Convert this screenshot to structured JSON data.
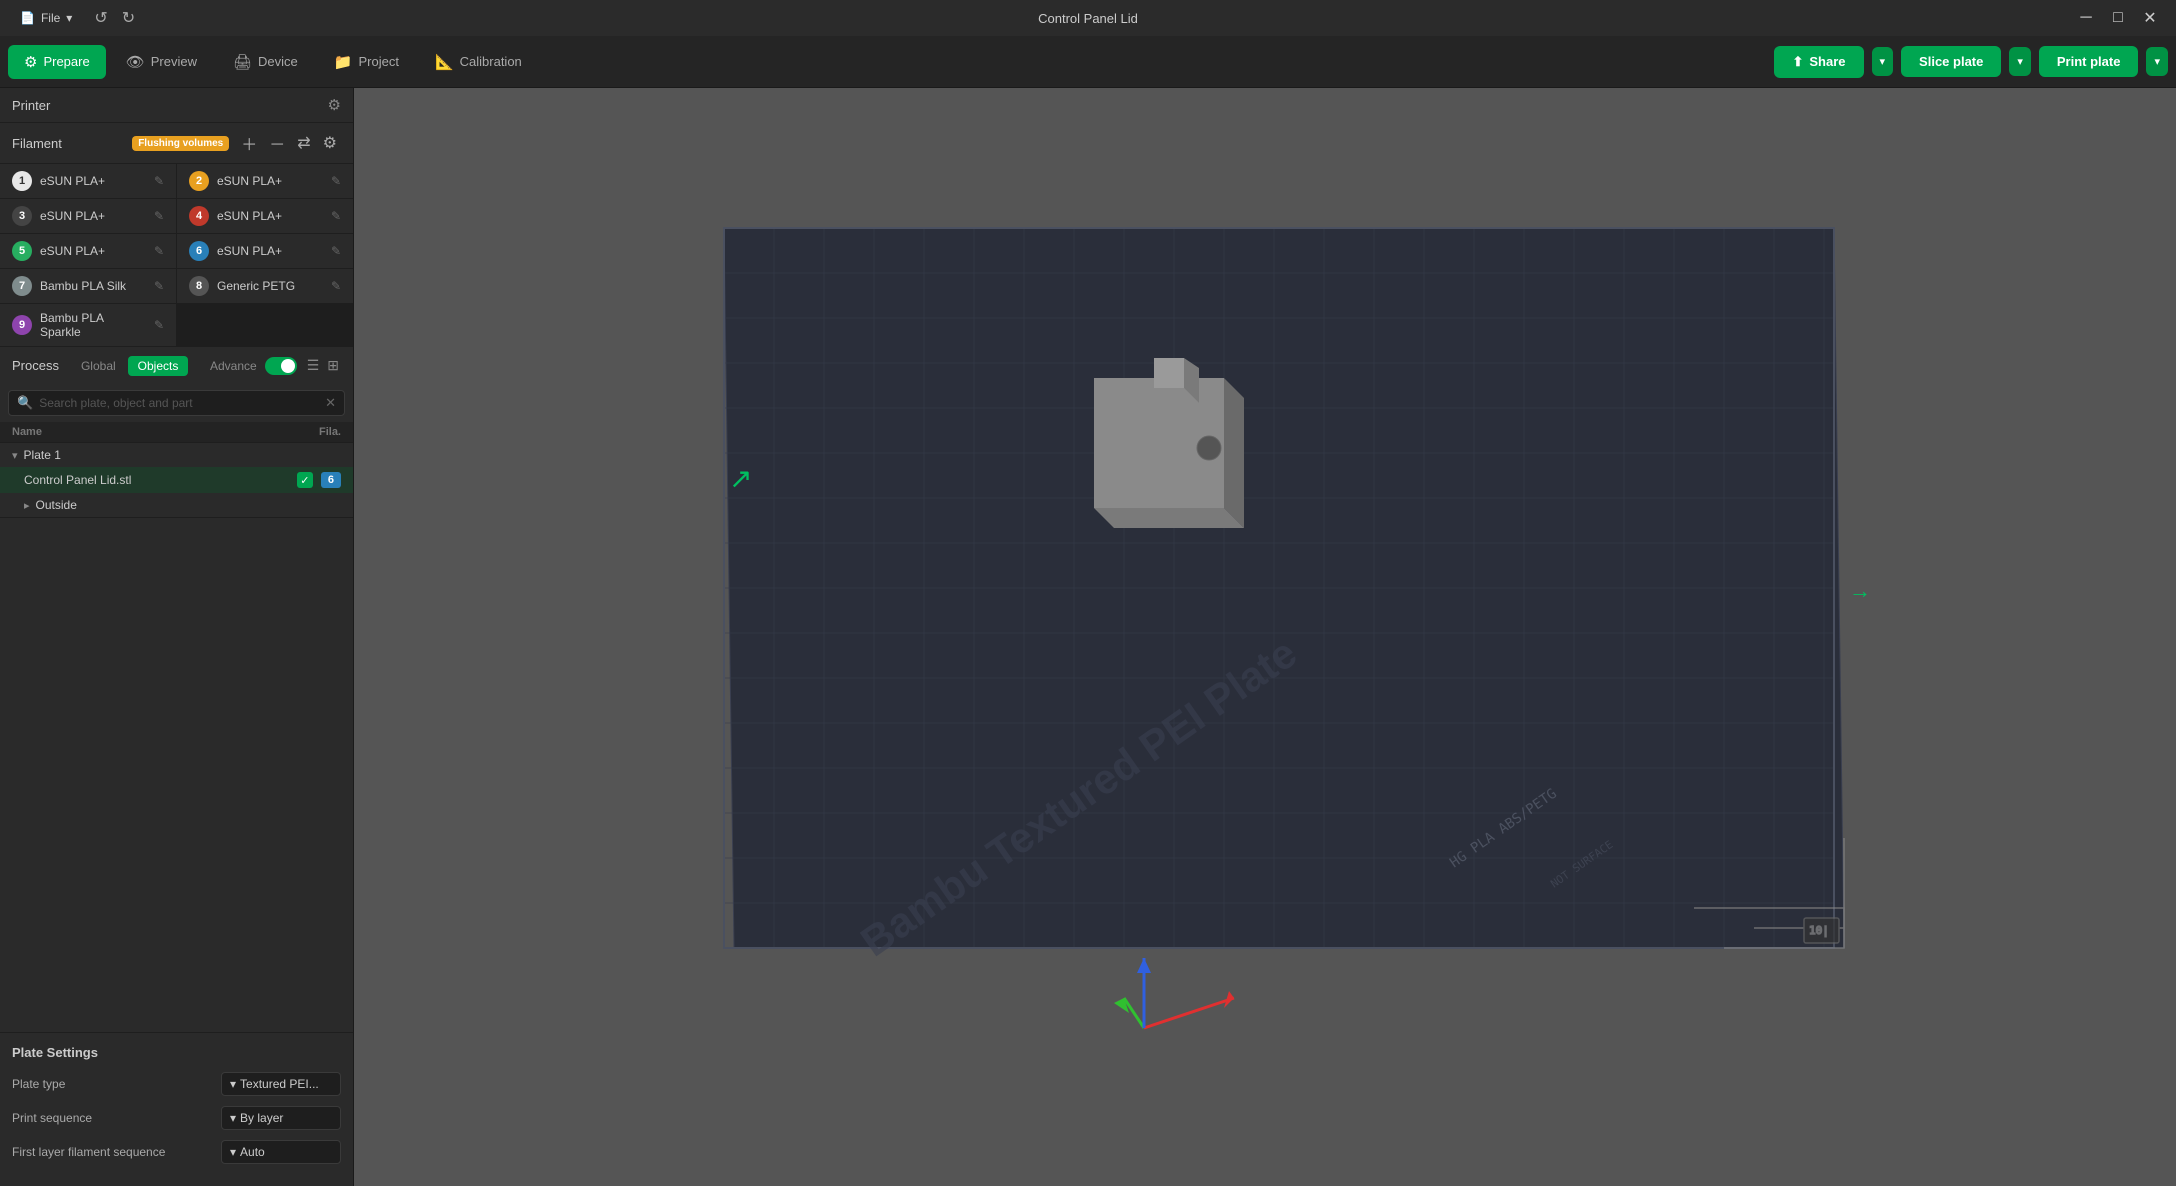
{
  "titleBar": {
    "fileMenu": "File",
    "title": "Control Panel Lid",
    "minimize": "─",
    "maximize": "□",
    "close": "✕"
  },
  "toolbar": {
    "tabs": [
      {
        "id": "prepare",
        "label": "Prepare",
        "icon": "⚙",
        "active": true
      },
      {
        "id": "preview",
        "label": "Preview",
        "icon": "👁",
        "active": false
      },
      {
        "id": "device",
        "label": "Device",
        "icon": "🖨",
        "active": false
      },
      {
        "id": "project",
        "label": "Project",
        "icon": "📁",
        "active": false
      },
      {
        "id": "calibration",
        "label": "Calibration",
        "icon": "📐",
        "active": false
      }
    ],
    "shareLabel": "Share",
    "sliceLabel": "Slice plate",
    "printLabel": "Print plate"
  },
  "sidebar": {
    "printer": {
      "label": "Printer"
    },
    "filament": {
      "label": "Filament",
      "badge": "Flushing volumes",
      "items": [
        {
          "num": "1",
          "color": "fn-1",
          "name": "eSUN PLA+"
        },
        {
          "num": "2",
          "color": "fn-2",
          "name": "eSUN PLA+"
        },
        {
          "num": "3",
          "color": "fn-3",
          "name": "eSUN PLA+"
        },
        {
          "num": "4",
          "color": "fn-4",
          "name": "eSUN PLA+"
        },
        {
          "num": "5",
          "color": "fn-5",
          "name": "eSUN PLA+"
        },
        {
          "num": "6",
          "color": "fn-6",
          "name": "eSUN PLA+"
        },
        {
          "num": "7",
          "color": "fn-7",
          "name": "Bambu PLA Silk"
        },
        {
          "num": "8",
          "color": "fn-8",
          "name": "Generic PETG"
        },
        {
          "num": "9",
          "color": "fn-9",
          "name": "Bambu PLA Sparkle"
        }
      ]
    },
    "process": {
      "label": "Process",
      "tabs": [
        "Global",
        "Objects"
      ],
      "activeTab": "Objects",
      "advance": "Advance",
      "searchPlaceholder": "Search plate, object and part",
      "columns": {
        "name": "Name",
        "fila": "Fila."
      },
      "plate1": "Plate 1",
      "object": "Control Panel Lid.stl",
      "objectFila": "6",
      "outside": "Outside"
    },
    "plateSettings": {
      "title": "Plate Settings",
      "rows": [
        {
          "label": "Plate type",
          "value": "Textured PEI...",
          "arrow": "▾"
        },
        {
          "label": "Print sequence",
          "value": "By layer",
          "arrow": "▾"
        },
        {
          "label": "First layer filament sequence",
          "value": "Auto",
          "arrow": "▾"
        }
      ]
    }
  },
  "viewport": {
    "bedText": "Bambu Textured PEI Plate",
    "bottomText": "HG PLA ABS /PETG",
    "cornerText": "NOT SURFACE"
  },
  "colors": {
    "accent": "#00a651",
    "bg": "#555555",
    "sidebar": "#2a2a2a",
    "titlebar": "#2b2b2b"
  }
}
